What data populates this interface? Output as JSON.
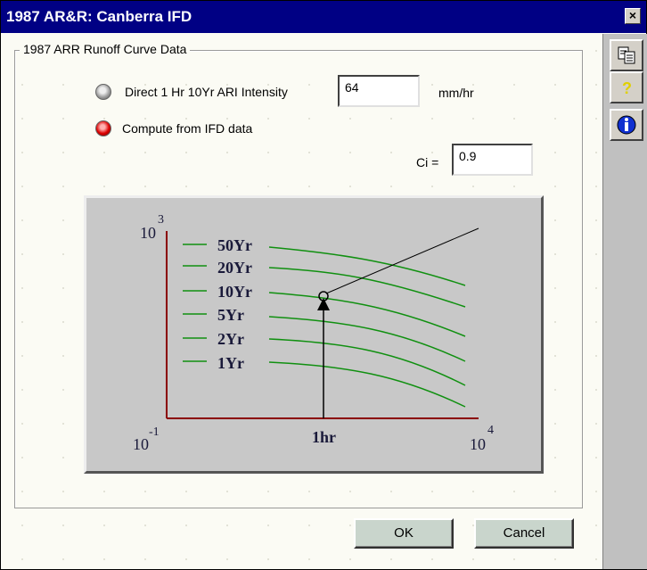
{
  "window": {
    "title": "1987 AR&R: Canberra IFD",
    "close_glyph": "×"
  },
  "group": {
    "label": "1987 ARR Runoff Curve Data"
  },
  "options": {
    "direct": {
      "label": "Direct 1 Hr 10Yr ARI Intensity",
      "value": "64",
      "unit": "mm/hr",
      "selected": false
    },
    "compute": {
      "label": "Compute from IFD data",
      "selected": true
    }
  },
  "ci": {
    "label": "Ci =",
    "value": "0.9"
  },
  "chart": {
    "curves": [
      "50Yr",
      "20Yr",
      "10Yr",
      "5Yr",
      "2Yr",
      "1Yr"
    ],
    "y_top_base": "10",
    "y_top_exp": "3",
    "y_bottom_base": "10",
    "y_bottom_exp": "-1",
    "x_right_base": "10",
    "x_right_exp": "4",
    "x_mid_label": "1hr",
    "colors": {
      "curve": "#109010",
      "axis": "#8b0000",
      "marker": "#000000"
    }
  },
  "buttons": {
    "ok": "OK",
    "cancel": "Cancel"
  },
  "side_icons": [
    "copy-icon",
    "help-icon",
    "info-icon"
  ]
}
